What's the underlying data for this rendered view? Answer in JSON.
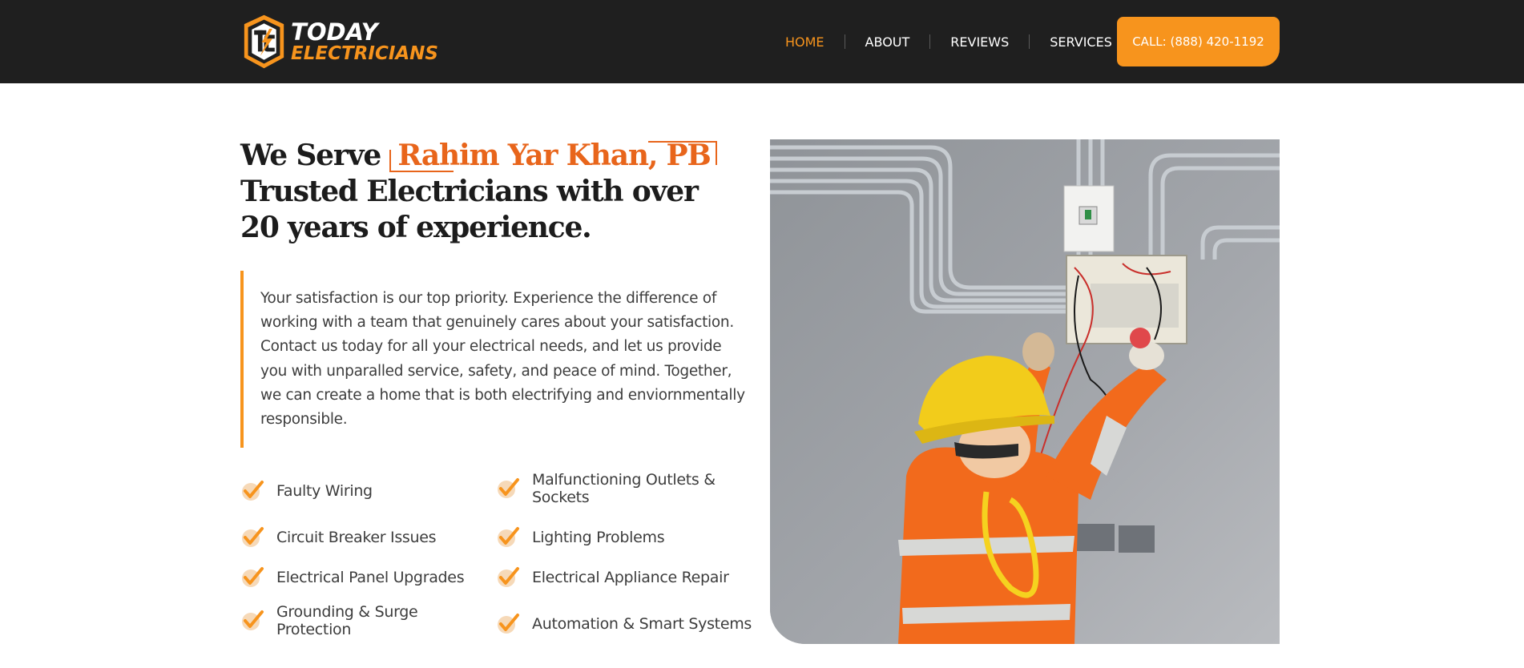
{
  "brand": {
    "line1": "TODAY",
    "line2": "ELECTRICIANS",
    "logo_icon": "tc-shield-logo-icon",
    "accent_color": "#f7941d",
    "header_bg": "#1f1f1f"
  },
  "nav": {
    "items": [
      {
        "label": "HOME",
        "active": true
      },
      {
        "label": "ABOUT",
        "active": false
      },
      {
        "label": "REVIEWS",
        "active": false
      },
      {
        "label": "SERVICES",
        "active": false
      }
    ],
    "call_label": "CALL: (888) 420-1192"
  },
  "hero": {
    "headline_prefix": "We Serve",
    "location": "Rahim Yar Khan, PB",
    "headline_rest": "Trusted Electricians with over 20 years of experience.",
    "intro": "Your satisfaction is our top priority. Experience the difference of working with a team that genuinely cares about your satisfaction. Contact us today for all your electrical needs, and let us provide you with unparalled service, safety, and peace of mind. Together, we can create a home that is both electrifying and enviornmentally responsible.",
    "location_color": "#e8651b"
  },
  "features": {
    "icon": "checkmark-icon",
    "items": [
      "Faulty Wiring",
      "Malfunctioning Outlets & Sockets",
      "Circuit Breaker Issues",
      "Lighting Problems",
      "Electrical Panel Upgrades",
      "Electrical Appliance Repair",
      "Grounding & Surge Protection",
      "Automation & Smart Systems"
    ]
  },
  "photo": {
    "subject": "electrician-working-on-panel-image"
  }
}
